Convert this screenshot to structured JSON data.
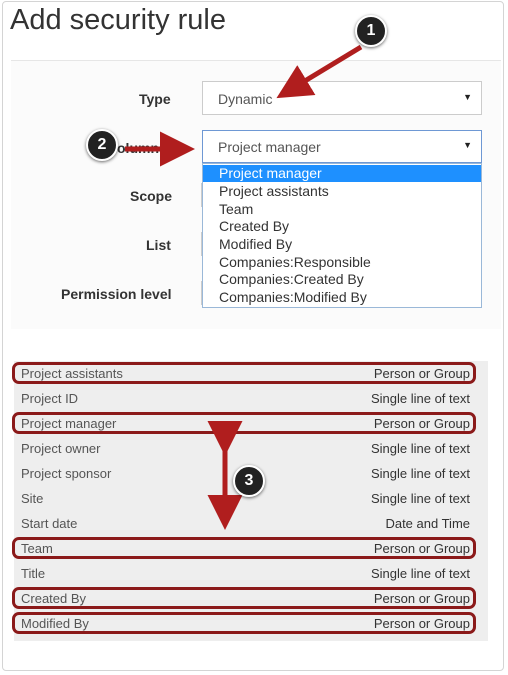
{
  "title": "Add security rule",
  "form": {
    "type_label": "Type",
    "type_value": "Dynamic",
    "field_label_partial": "olumn",
    "field_value": "Project manager",
    "scope_label": "Scope",
    "list_label": "List",
    "permission_label": "Permission level",
    "caret": "▼"
  },
  "dropdown": {
    "options": [
      "Project manager",
      "Project assistants",
      "Team",
      "Created By",
      "Modified By",
      "Companies:Responsible",
      "Companies:Created By",
      "Companies:Modified By"
    ],
    "selected_index": 0
  },
  "columns": [
    {
      "name": "Project assistants",
      "type": "Person or Group",
      "highlighted": true
    },
    {
      "name": "Project ID",
      "type": "Single line of text",
      "highlighted": false
    },
    {
      "name": "Project manager",
      "type": "Person or Group",
      "highlighted": true
    },
    {
      "name": "Project owner",
      "type": "Single line of text",
      "highlighted": false
    },
    {
      "name": "Project sponsor",
      "type": "Single line of text",
      "highlighted": false
    },
    {
      "name": "Site",
      "type": "Single line of text",
      "highlighted": false
    },
    {
      "name": "Start date",
      "type": "Date and Time",
      "highlighted": false
    },
    {
      "name": "Team",
      "type": "Person or Group",
      "highlighted": true
    },
    {
      "name": "Title",
      "type": "Single line of text",
      "highlighted": false
    },
    {
      "name": "Created By",
      "type": "Person or Group",
      "highlighted": true
    },
    {
      "name": "Modified By",
      "type": "Person or Group",
      "highlighted": true
    }
  ],
  "callouts": [
    "1",
    "2",
    "3"
  ],
  "colors": {
    "accent_arrow": "#b01e1e",
    "highlight_border": "#8b1a1a",
    "selected_option": "#1e90ff",
    "badge": "#222222"
  }
}
